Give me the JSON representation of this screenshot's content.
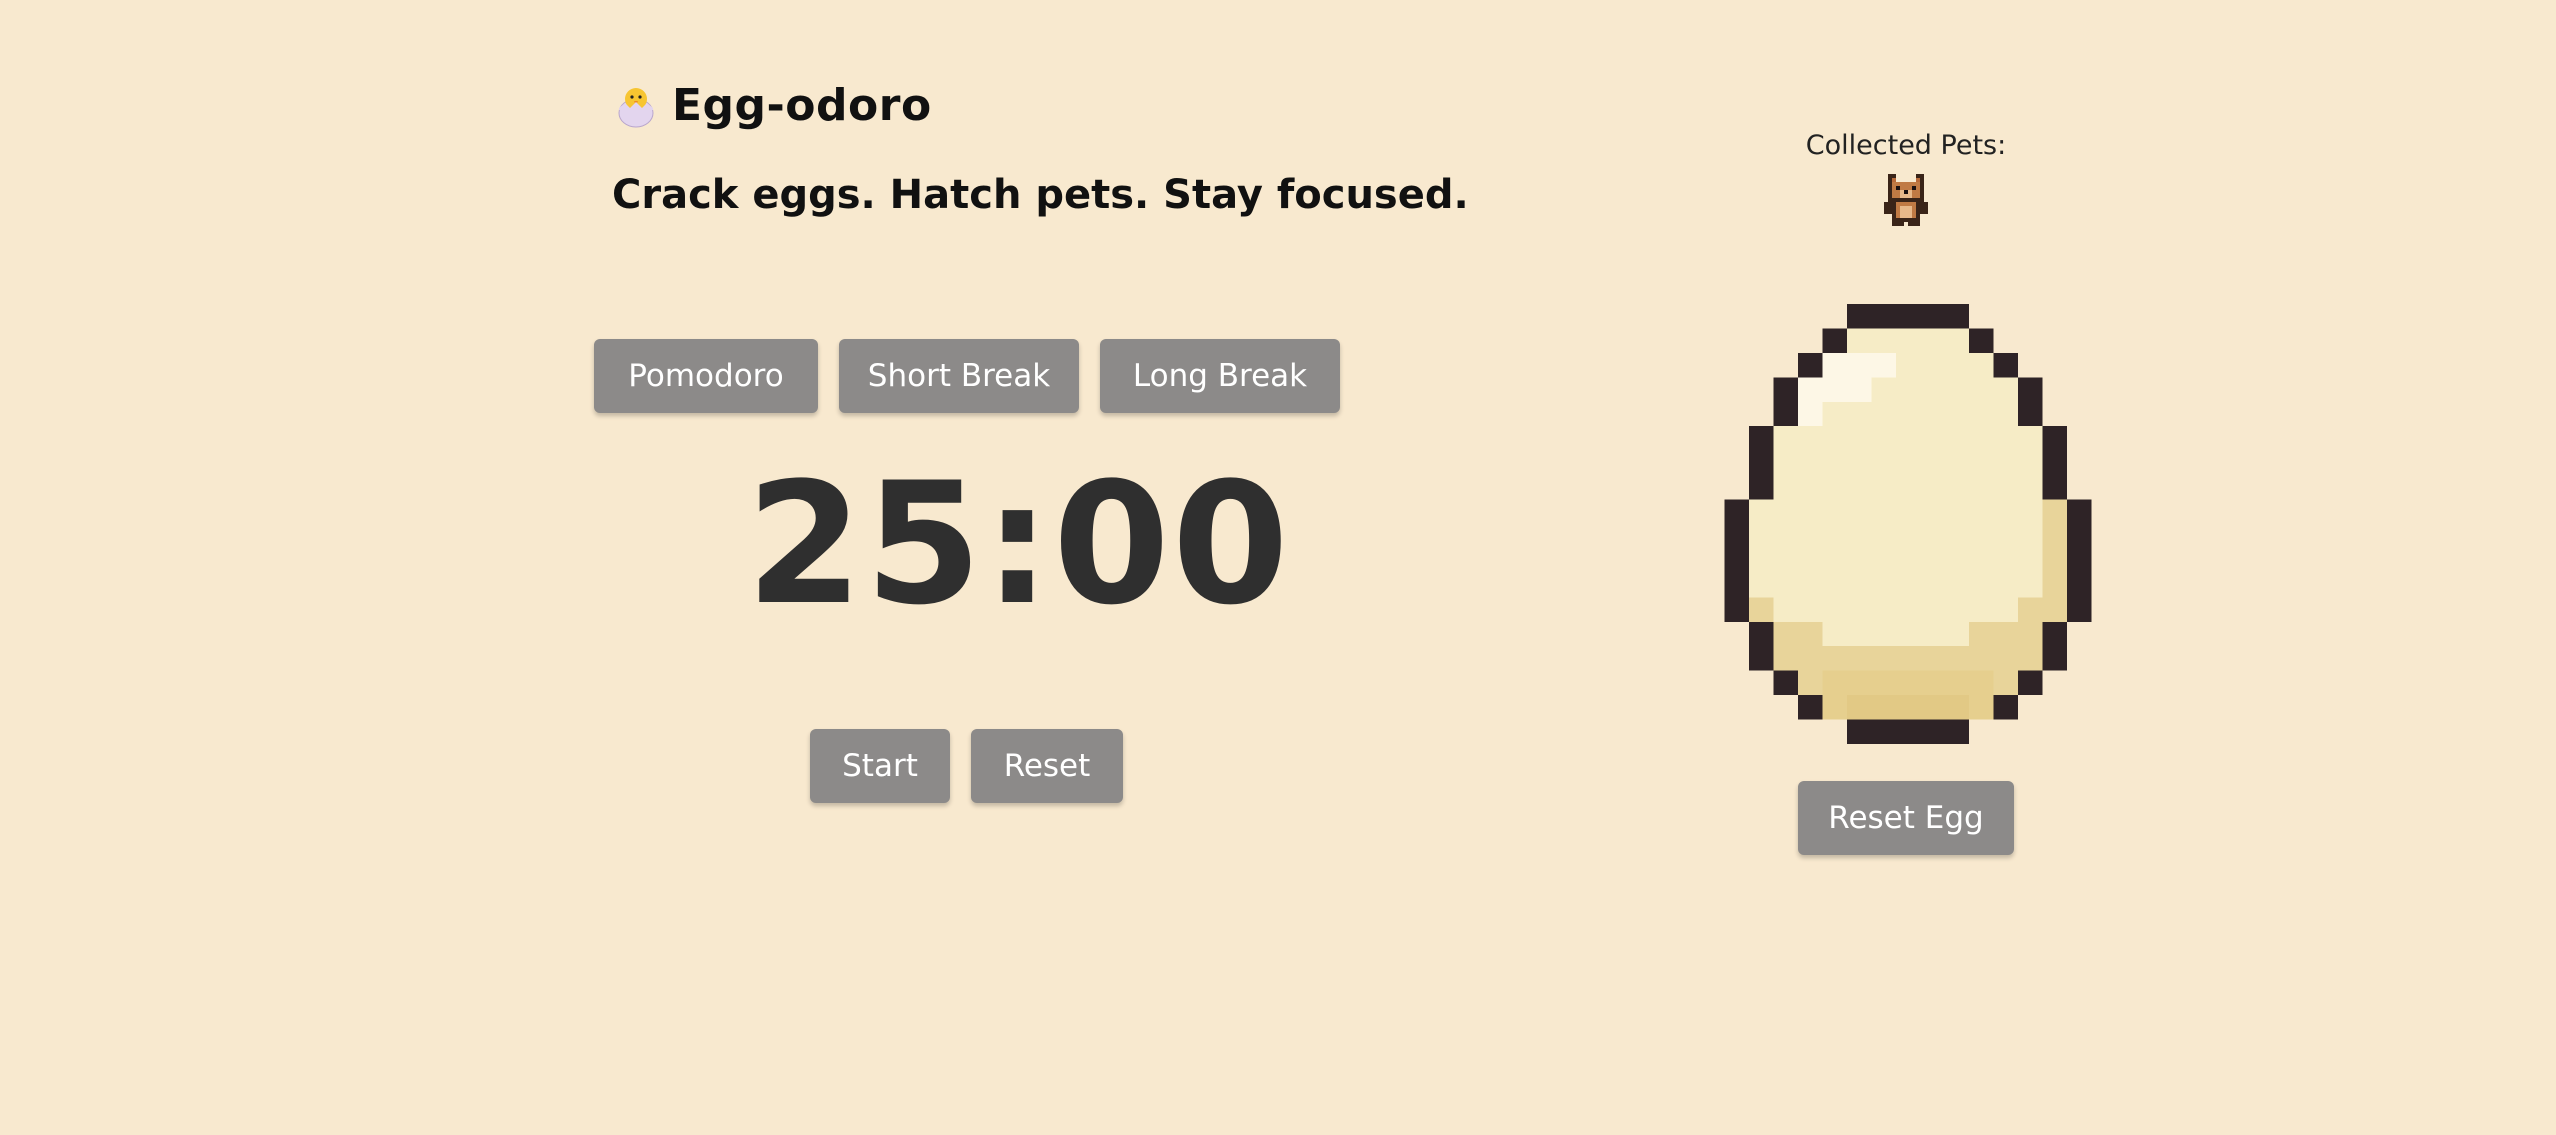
{
  "app": {
    "title": "Egg-odoro",
    "tagline": "Crack eggs. Hatch pets. Stay focused.",
    "logo_icon": "hatching-chick-icon"
  },
  "modes": {
    "pomodoro_label": "Pomodoro",
    "short_break_label": "Short Break",
    "long_break_label": "Long Break"
  },
  "timer": {
    "display": "25:00"
  },
  "controls": {
    "start_label": "Start",
    "reset_label": "Reset"
  },
  "pets": {
    "label": "Collected Pets:",
    "items": [
      {
        "icon": "bear-pet-icon"
      }
    ]
  },
  "egg": {
    "icon": "pixel-egg-icon",
    "reset_label": "Reset Egg"
  },
  "colors": {
    "background": "#f8e9cf",
    "button": "#8c8a89",
    "button_text": "#ffffff",
    "timer_text": "#2f2f2f"
  }
}
